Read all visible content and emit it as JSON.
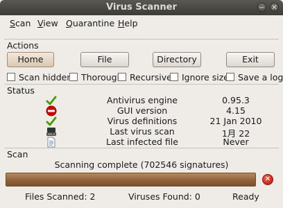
{
  "window": {
    "title": "Virus Scanner",
    "minimize_glyph": "−",
    "close_glyph": "✕"
  },
  "menubar": [
    {
      "first": "S",
      "rest": "can"
    },
    {
      "first": "V",
      "rest": "iew"
    },
    {
      "first": "Q",
      "rest": "uarantine"
    },
    {
      "first": "H",
      "rest": "elp"
    }
  ],
  "actions": {
    "label": "Actions",
    "buttons": [
      "Home",
      "File",
      "Directory",
      "Exit"
    ],
    "checkboxes": [
      "Scan hidden",
      "Thorough",
      "Recursive",
      "Ignore size",
      "Save a log"
    ]
  },
  "status": {
    "label": "Status",
    "rows": [
      {
        "icon": "checkmark-icon",
        "label": "Antivirus engine",
        "value": "0.95.3"
      },
      {
        "icon": "no-entry-icon",
        "label": "GUI version",
        "value": "4.15"
      },
      {
        "icon": "checkmark-icon",
        "label": "Virus definitions",
        "value": "21 Jan 2010"
      },
      {
        "icon": "hard-drive-icon",
        "label": "Last virus scan",
        "value": "1月  22"
      },
      {
        "icon": "document-icon",
        "label": "Last infected file",
        "value": "Never"
      }
    ]
  },
  "scan": {
    "label": "Scan",
    "message": "Scanning complete (702546 signatures)",
    "progress": 1.0,
    "files_scanned": "Files Scanned: 2",
    "viruses_found": "Viruses Found: 0",
    "state": "Ready"
  },
  "colors": {
    "titlebar": "#4a4843",
    "window_bg": "#efebe7",
    "progress": "#8c6038",
    "stop": "#c4261a"
  }
}
